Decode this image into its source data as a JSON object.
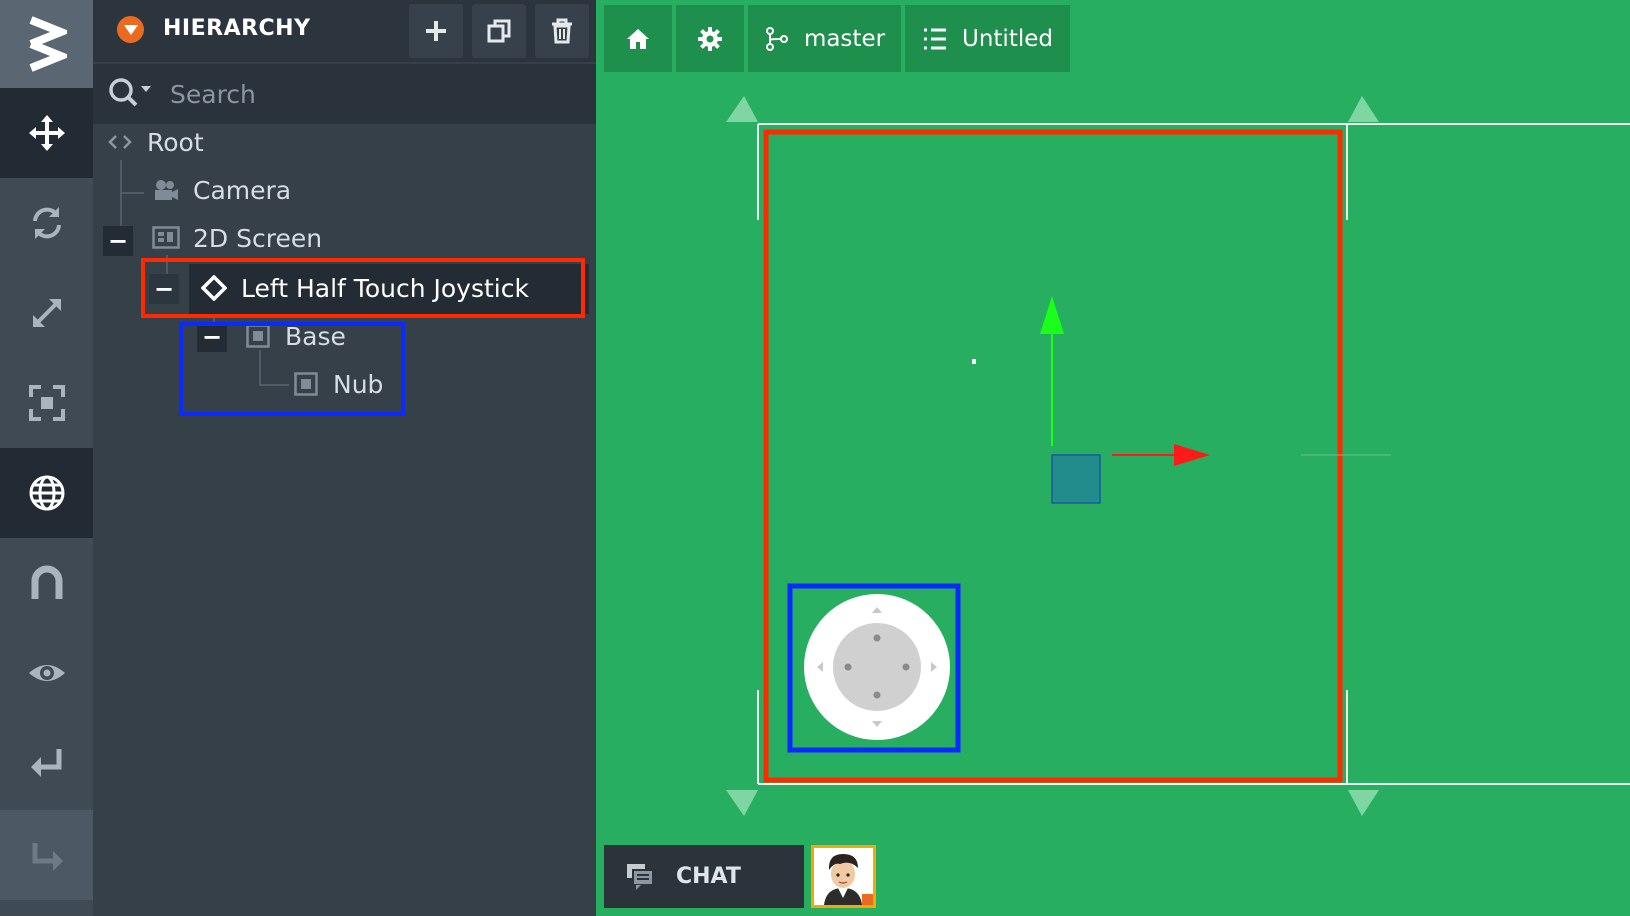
{
  "hierarchy": {
    "title": "HIERARCHY",
    "search_placeholder": "Search",
    "tree": {
      "root": "Root",
      "camera": "Camera",
      "screen": "2D Screen",
      "joystick": "Left Half Touch Joystick",
      "base": "Base",
      "nub": "Nub"
    }
  },
  "scene_toolbar": {
    "branch": "master",
    "project": "Untitled"
  },
  "chat": {
    "label": "CHAT"
  },
  "colors": {
    "viewport_bg": "#27ae60",
    "panel_bg": "#364049",
    "selection_red": "#ff2a00",
    "selection_blue": "#0a2aff",
    "accent_orange": "#e86b1f",
    "gizmo_green": "#1aff1a",
    "gizmo_red": "#ff1a1a"
  },
  "icons": [
    "logo-icon",
    "move-icon",
    "rotate-icon",
    "scale-icon",
    "rect-icon",
    "globe-icon",
    "magnet-icon",
    "eye-icon",
    "undo-icon",
    "redo-icon",
    "plus-icon",
    "copy-icon",
    "trash-icon",
    "search-icon",
    "home-icon",
    "gear-icon",
    "branch-icon",
    "list-icon",
    "chat-icon"
  ]
}
